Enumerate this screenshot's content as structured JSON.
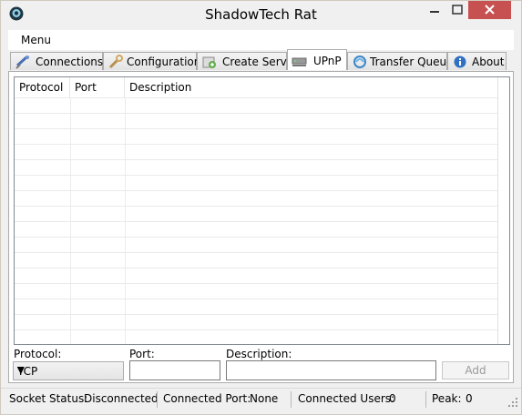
{
  "window": {
    "title": "ShadowTech Rat"
  },
  "menu": {
    "items": [
      "Menu"
    ]
  },
  "tabs": [
    {
      "label": "Connections",
      "icon": "satellite-icon"
    },
    {
      "label": "Configuration",
      "icon": "wrench-icon"
    },
    {
      "label": "Create Server",
      "icon": "server-create-icon"
    },
    {
      "label": "UPnP",
      "icon": "router-icon",
      "active": true
    },
    {
      "label": "Transfer Queue",
      "icon": "transfer-icon"
    },
    {
      "label": "About",
      "icon": "info-icon"
    }
  ],
  "list": {
    "columns": [
      "Protocol",
      "Port",
      "Description"
    ]
  },
  "form": {
    "protocol_label": "Protocol:",
    "protocol_value": "TCP",
    "port_label": "Port:",
    "port_value": "",
    "description_label": "Description:",
    "description_value": "",
    "add_label": "Add"
  },
  "status": {
    "socket_label": "Socket Status:",
    "socket_value": "Disconnected",
    "port_label": "Connected Port:",
    "port_value": "None",
    "users_label": "Connected Users:",
    "users_value": "0",
    "peak_label": "Peak:",
    "peak_value": "0"
  },
  "colors": {
    "close_button": "#c75050",
    "disabled_text": "#9a9a9a"
  }
}
